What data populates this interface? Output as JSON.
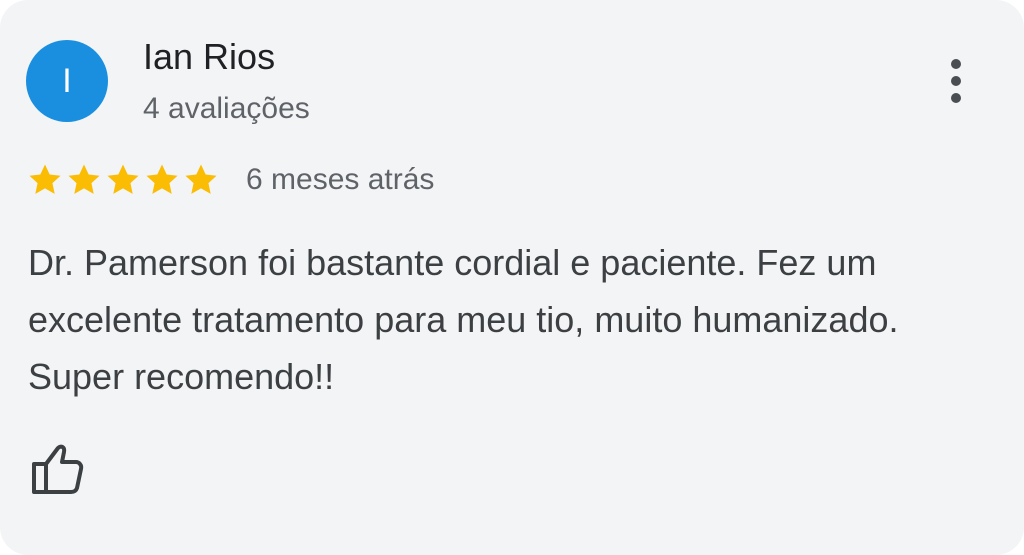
{
  "review": {
    "avatar_initial": "I",
    "avatar_color": "#1a8fe0",
    "reviewer_name": "Ian Rios",
    "reviewer_meta": "4 avaliações",
    "rating": 5,
    "rating_max": 5,
    "star_color": "#fbbc04",
    "time_ago": "6 meses atrás",
    "text": "Dr. Pamerson foi bastante cordial e paciente. Fez um excelente tratamento para meu tio, muito humanizado. Super recomendo!!",
    "more_icon": "more-vert-icon",
    "like_icon": "thumbs-up-icon"
  }
}
